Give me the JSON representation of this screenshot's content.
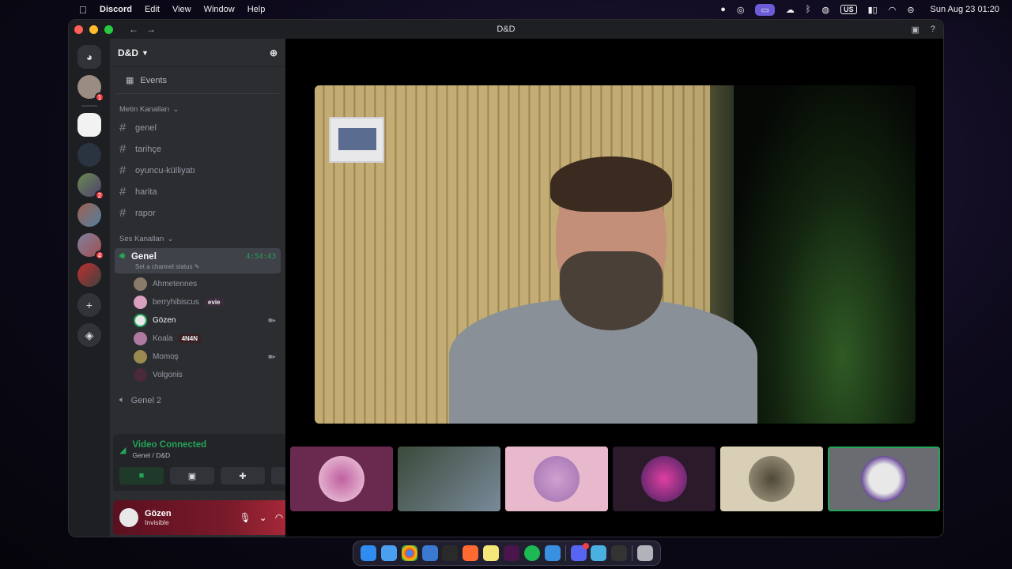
{
  "menubar": {
    "app_name": "Discord",
    "items": [
      "Edit",
      "View",
      "Window",
      "Help"
    ],
    "keyboard": "US",
    "clock": "Sun Aug 23  01:20"
  },
  "window": {
    "title": "D&D"
  },
  "rail": {
    "badges": [
      "1",
      "2",
      "4"
    ]
  },
  "sidebar": {
    "guild_name": "D&D",
    "events_label": "Events",
    "text_category": "Metin Kanalları",
    "text_channels": [
      "genel",
      "tarihçe",
      "oyuncu-külliyatı",
      "harita",
      "rapor"
    ],
    "voice_category": "Ses Kanalları",
    "active_voice": {
      "name": "Genel",
      "timer": "4:54:43",
      "status_placeholder": "Set a channel status"
    },
    "members": [
      {
        "name": "Ahmetennes",
        "tag": "",
        "color": "#8a7a6a"
      },
      {
        "name": "berryhibiscus",
        "tag": "evie",
        "color": "#d9a0c0"
      },
      {
        "name": "Gözen",
        "tag": "",
        "color": "#e8e8e8"
      },
      {
        "name": "Koala",
        "tag": "4N4N",
        "color": "#b07aa0"
      },
      {
        "name": "Momoş",
        "tag": "",
        "color": "#9a8a50"
      },
      {
        "name": "Volgonis",
        "tag": "",
        "color": "#4a2a3a"
      }
    ],
    "other_voice": "Genel 2"
  },
  "connection": {
    "title": "Video Connected",
    "subtitle": "Genel / D&D"
  },
  "user": {
    "name": "Gözen",
    "status": "Invisible"
  },
  "colors": {
    "accent_green": "#23a559",
    "sidebar_bg": "#2b2d31",
    "rail_bg": "#1e1f22",
    "badge_red": "#f23f43"
  },
  "icons": [
    "discord-logo-icon",
    "speaker-icon",
    "hash-icon",
    "camera-icon",
    "screen-share-icon",
    "activities-icon",
    "soundboard-icon",
    "mic-icon",
    "headphones-icon",
    "settings-icon",
    "hangup-icon",
    "invite-icon"
  ]
}
